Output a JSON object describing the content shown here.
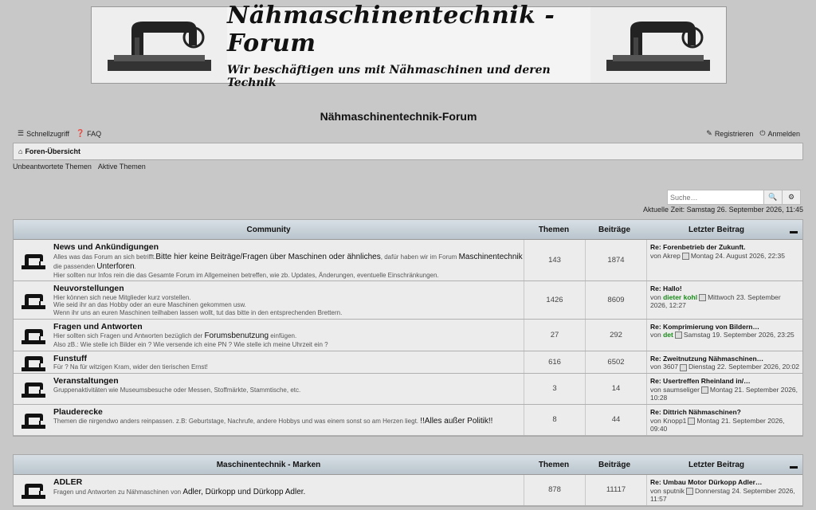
{
  "banner": {
    "title": "Nähmaschinentechnik - Forum",
    "subtitle": "Wir beschäftigen uns mit Nähmaschinen und deren Technik"
  },
  "site_title": "Nähmaschinentechnik-Forum",
  "topnav": {
    "quick": "Schnellzugriff",
    "faq": "FAQ",
    "register": "Registrieren",
    "login": "Anmelden"
  },
  "breadcrumb": "Foren-Übersicht",
  "sublinks": [
    "Unbeantwortete Themen",
    "Aktive Themen"
  ],
  "search": {
    "placeholder": "Suche…"
  },
  "current_time": "Aktuelle Zeit: Samstag 26. September 2026, 11:45",
  "columns": {
    "topics": "Themen",
    "posts": "Beiträge",
    "last": "Letzter Beitrag"
  },
  "categories": [
    {
      "name": "Community",
      "forums": [
        {
          "title": "News und Ankündigungen",
          "desc": [
            {
              "t": "Alles was das Forum an sich betrifft."
            },
            {
              "t": "Bitte hier keine Beiträge/Fragen über Maschinen oder ähnliches",
              "hl": true
            },
            {
              "t": ", dafür haben wir im Forum "
            },
            {
              "t": "Maschinentechnik",
              "hl": true
            },
            {
              "t": " die passenden "
            },
            {
              "t": "Unterforen",
              "hl": true
            },
            {
              "t": "."
            },
            {
              "t": "Hier sollten nur Infos rein die das Gesamte Forum im Allgemeinen betreffen, wie zb. Updates, Änderungen, eventuelle Einschränkungen."
            }
          ],
          "topics": "143",
          "posts": "1874",
          "last_title": "Re: Forenbetrieb der Zukunft.",
          "by": "von",
          "author": "Akrep",
          "green": false,
          "date": "Montag 24. August 2026, 22:35"
        },
        {
          "title": "Neuvorstellungen",
          "desc": [
            {
              "t": "Hier können sich neue Mitglieder kurz vorstellen."
            },
            {
              "t": "Wie seid ihr an das Hobby oder an eure Maschinen gekommen usw."
            },
            {
              "t": "Wenn ihr uns an euren Maschinen teilhaben lassen wollt, tut das bitte in den entsprechenden Brettern."
            }
          ],
          "topics": "1426",
          "posts": "8609",
          "last_title": "Re: Hallo!",
          "by": "von",
          "author": "dieter kohl",
          "green": true,
          "date": "Mittwoch 23. September 2026, 12:27"
        },
        {
          "title": "Fragen und Antworten",
          "desc": [
            {
              "t": "Hier sollten sich Fragen und Antworten bezüglich der "
            },
            {
              "t": "Forumsbenutzung",
              "hl": true
            },
            {
              "t": " einfügen."
            },
            {
              "t": "Also zB.: Wie stelle ich Bilder ein ? Wie versende ich eine PN ? Wie stelle ich meine Uhrzeit ein ?"
            }
          ],
          "topics": "27",
          "posts": "292",
          "last_title": "Re: Komprimierung von Bildern…",
          "by": "von",
          "author": "det",
          "green": true,
          "date": "Samstag 19. September 2026, 23:25"
        },
        {
          "title": "Funstuff",
          "desc": [
            {
              "t": "Für ? Na für witzigen Kram, wider den tierischen Ernst!"
            }
          ],
          "topics": "616",
          "posts": "6502",
          "last_title": "Re: Zweitnutzung Nähmaschinen…",
          "by": "von",
          "author": "3607",
          "green": false,
          "date": "Dienstag 22. September 2026, 20:02"
        },
        {
          "title": "Veranstaltungen",
          "desc": [
            {
              "t": "Gruppenaktivitäten wie Museumsbesuche oder Messen, Stoffmärkte, Stammtische, etc."
            }
          ],
          "topics": "3",
          "posts": "14",
          "last_title": "Re: Usertreffen Rheinland in/…",
          "by": "von",
          "author": "saumseliger",
          "green": false,
          "date": "Montag 21. September 2026, 10:28"
        },
        {
          "title": "Plauderecke",
          "desc": [
            {
              "t": "Themen die nirgendwo anders reinpassen. z.B: Geburtstage, Nachrufe, andere Hobbys und was einem sonst so am Herzen liegt. "
            },
            {
              "t": "!!Alles außer Politik!!",
              "hl": true
            }
          ],
          "topics": "8",
          "posts": "44",
          "last_title": "Re: Dittrich Nähmaschinen?",
          "by": "von",
          "author": "Knopp1",
          "green": false,
          "date": "Montag 21. September 2026, 09:40"
        }
      ]
    },
    {
      "name": "Maschinentechnik - Marken",
      "forums": [
        {
          "title": "ADLER",
          "desc": [
            {
              "t": "Fragen und Antworten zu Nähmaschinen von "
            },
            {
              "t": "Adler, Dürkopp und Dürkopp Adler.",
              "hl": true
            }
          ],
          "topics": "878",
          "posts": "11117",
          "last_title": "Re: Umbau Motor Dürkopp Adler…",
          "by": "von",
          "author": "sputnik",
          "green": false,
          "date": "Donnerstag 24. September 2026, 11:57"
        }
      ]
    }
  ],
  "colors": {
    "background": "#c8c8c8",
    "header_top": "#d8e0e6",
    "header_bottom": "#b9c4cc",
    "green_user": "#1a8a1a"
  },
  "icons": [
    "hamburger-icon",
    "question-icon",
    "edit-icon",
    "power-icon",
    "home-icon",
    "search-icon",
    "gear-icon",
    "sewing-machine-icon",
    "collapse-icon",
    "post-icon"
  ]
}
